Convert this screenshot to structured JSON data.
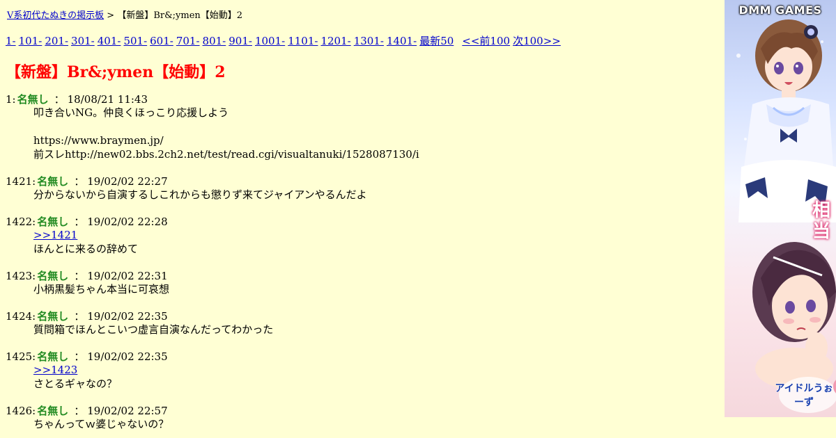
{
  "breadcrumb": {
    "board_link": "V系初代たぬきの掲示板",
    "separator": ">",
    "current": "【新盤】Br&;ymen【始動】2"
  },
  "pager": {
    "links": [
      "1-",
      "101-",
      "201-",
      "301-",
      "401-",
      "501-",
      "601-",
      "701-",
      "801-",
      "901-",
      "1001-",
      "1101-",
      "1201-",
      "1301-",
      "1401-",
      "最新50"
    ],
    "prev": "<<前100",
    "next": "次100>>"
  },
  "thread_title": "【新盤】Br&;ymen【始動】2",
  "posts": [
    {
      "num": "1:",
      "name": "名無し",
      "sep": "：",
      "date": "18/08/21 11:43",
      "lines": [
        "叩き合いNG。仲良くほっこり応援しよう",
        "",
        "https://www.braymen.jp/",
        "前スレhttp://new02.bbs.2ch2.net/test/read.cgi/visualtanuki/1528087130/i"
      ]
    },
    {
      "num": "1421:",
      "name": "名無し",
      "sep": "：",
      "date": "19/02/02 22:27",
      "lines": [
        "分からないから自演するしこれからも懲りず来てジャイアンやるんだよ"
      ]
    },
    {
      "num": "1422:",
      "name": "名無し",
      "sep": "：",
      "date": "19/02/02 22:28",
      "anchor": ">>1421",
      "lines": [
        "ほんとに来るの辞めて"
      ]
    },
    {
      "num": "1423:",
      "name": "名無し",
      "sep": "：",
      "date": "19/02/02 22:31",
      "lines": [
        "小柄黒髪ちゃん本当に可哀想"
      ]
    },
    {
      "num": "1424:",
      "name": "名無し",
      "sep": "：",
      "date": "19/02/02 22:35",
      "lines": [
        "質問箱でほんとこいつ虚言自演なんだってわかった"
      ]
    },
    {
      "num": "1425:",
      "name": "名無し",
      "sep": "：",
      "date": "19/02/02 22:35",
      "anchor": ">>1423",
      "lines": [
        "さとるギャなの？"
      ]
    },
    {
      "num": "1426:",
      "name": "名無し",
      "sep": "：",
      "date": "19/02/02 22:57",
      "lines": [
        "ちゃんってｗ婆じゃないの？"
      ]
    }
  ],
  "ad": {
    "logo": "DMM GAMES",
    "badge": "相当",
    "footer": "アイドルうぉーず",
    "colors": {
      "logo": "#ffffff",
      "badge_glow": "#e0407a",
      "footer": "#1a3fae"
    }
  },
  "colors": {
    "background": "#ffffd4",
    "title": "#ff0000",
    "name": "#228b22",
    "link": "#0000cc"
  }
}
